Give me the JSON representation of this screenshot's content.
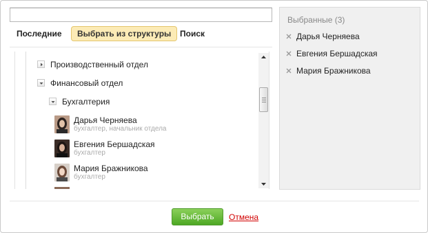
{
  "search": {
    "value": "",
    "placeholder": ""
  },
  "tabs": [
    {
      "label": "Последние"
    },
    {
      "label": "Выбрать из структуры",
      "active": true
    },
    {
      "label": "Поиск"
    }
  ],
  "tree": {
    "departments": [
      {
        "label": "Производственный отдел",
        "expanded": false
      },
      {
        "label": "Финансовый отдел",
        "expanded": true
      }
    ],
    "subdepartment": {
      "label": "Бухгалтерия",
      "expanded": true
    },
    "employees": [
      {
        "name": "Дарья Черняева",
        "title": "бухгалтер, начальник отдела"
      },
      {
        "name": "Евгения Бершадская",
        "title": "бухгалтер"
      },
      {
        "name": "Мария Бражникова",
        "title": "бухгалтер"
      }
    ]
  },
  "selected": {
    "title": "Выбранные (3)",
    "items": [
      {
        "name": "Дарья Черняева"
      },
      {
        "name": "Евгения Бершадская"
      },
      {
        "name": "Мария Бражникова"
      }
    ]
  },
  "footer": {
    "choose_label": "Выбрать",
    "cancel_label": "Отмена"
  },
  "colors": {
    "accent_tab": "#fcebb6",
    "button_green": "#4da824",
    "cancel_red": "#d10000",
    "panel_bg": "#f0f0f0"
  }
}
